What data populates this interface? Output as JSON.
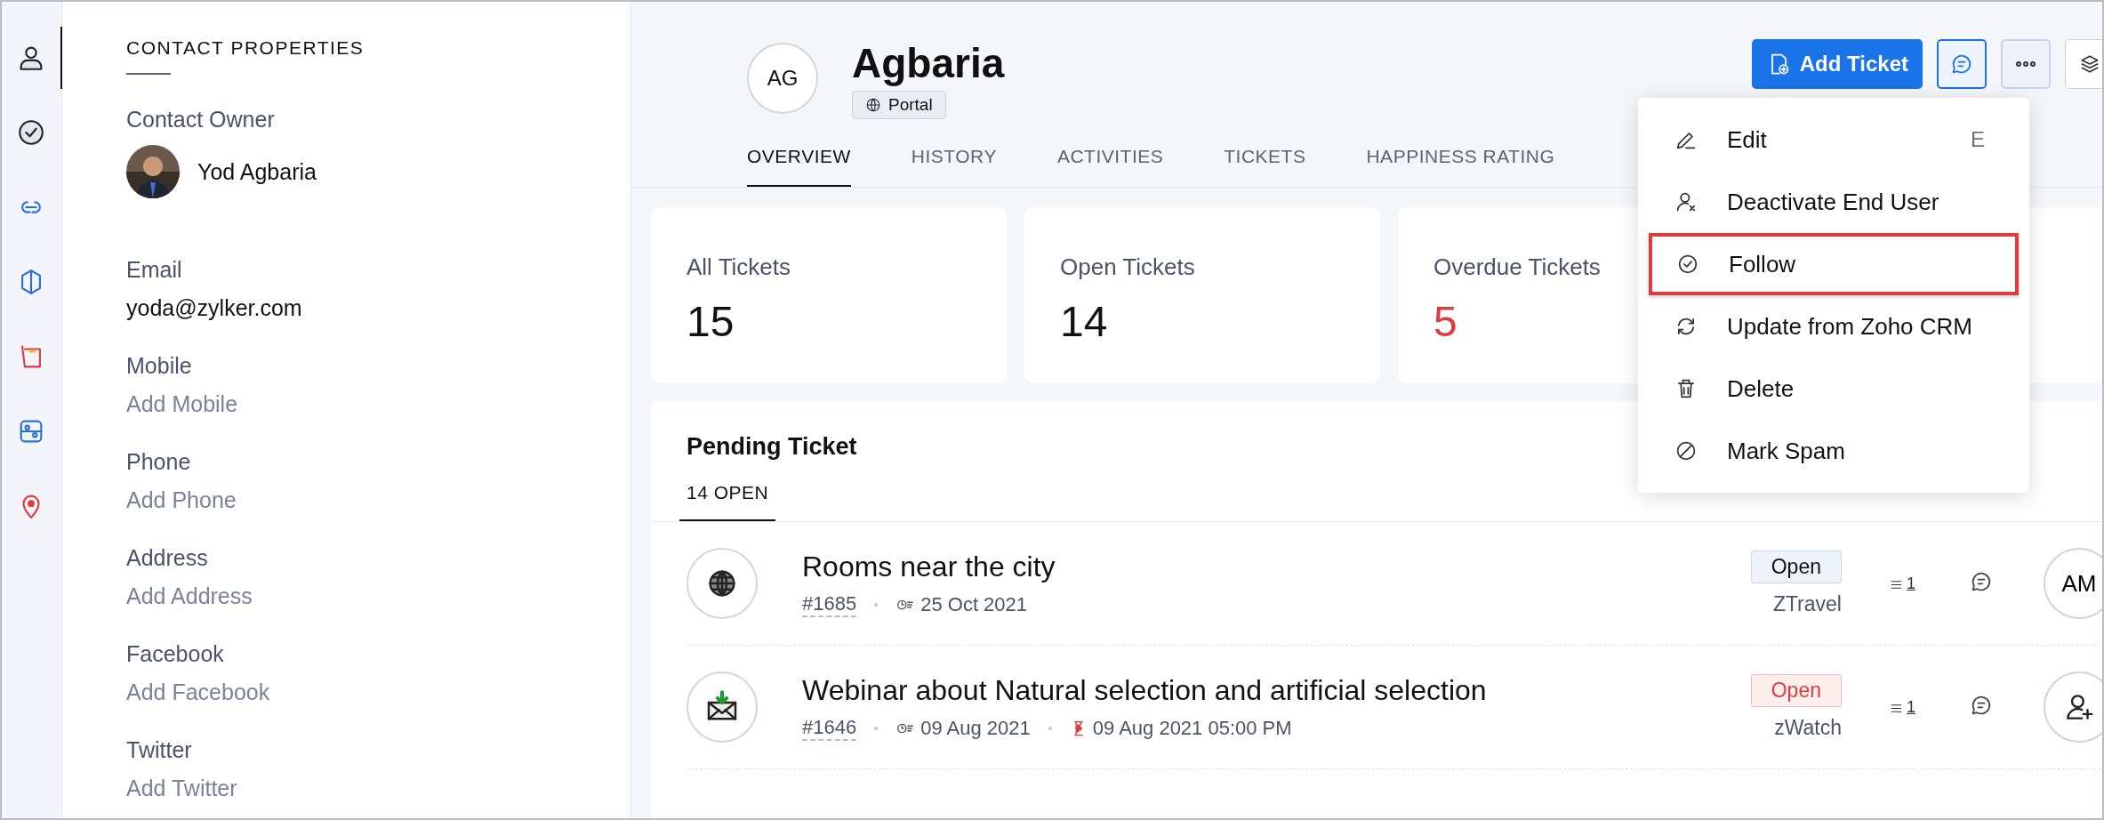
{
  "rail": [
    {
      "kind": "contact",
      "selected": true
    },
    {
      "kind": "check",
      "selected": false
    },
    {
      "kind": "link",
      "selected": false
    },
    {
      "kind": "hex",
      "selected": false
    },
    {
      "kind": "book",
      "selected": false
    },
    {
      "kind": "flow",
      "selected": false
    },
    {
      "kind": "pin",
      "selected": false
    }
  ],
  "properties": {
    "title": "CONTACT PROPERTIES",
    "owner": {
      "label": "Contact Owner",
      "name": "Yod Agbaria"
    },
    "fields": [
      {
        "label": "Email",
        "value": "yoda@zylker.com",
        "empty": false
      },
      {
        "label": "Mobile",
        "value": "Add Mobile",
        "empty": true
      },
      {
        "label": "Phone",
        "value": "Add Phone",
        "empty": true
      },
      {
        "label": "Address",
        "value": "Add Address",
        "empty": true
      },
      {
        "label": "Facebook",
        "value": "Add Facebook",
        "empty": true
      },
      {
        "label": "Twitter",
        "value": "Add Twitter",
        "empty": true
      }
    ]
  },
  "header": {
    "initials": "AG",
    "name": "Agbaria",
    "badge": "Portal",
    "add_button": "Add Ticket"
  },
  "tabs": [
    {
      "label": "OVERVIEW",
      "selected": true
    },
    {
      "label": "HISTORY",
      "selected": false
    },
    {
      "label": "ACTIVITIES",
      "selected": false
    },
    {
      "label": "TICKETS",
      "selected": false
    },
    {
      "label": "HAPPINESS RATING",
      "selected": false
    }
  ],
  "stats": [
    {
      "label": "All Tickets",
      "value": "15",
      "alert": false
    },
    {
      "label": "Open Tickets",
      "value": "14",
      "alert": false
    },
    {
      "label": "Overdue Tickets",
      "value": "5",
      "alert": true
    }
  ],
  "pending": {
    "title": "Pending Ticket",
    "tab": "14 OPEN",
    "rows": [
      {
        "kind": "web",
        "title": "Rooms near the city",
        "number": "#1685",
        "created": "25 Oct 2021",
        "status": "Open",
        "overdue": false,
        "department": "ZTravel",
        "thread_count": "1",
        "assignee": "AM"
      },
      {
        "kind": "email",
        "title": "Webinar about Natural selection and artificial selection",
        "number": "#1646",
        "created": "09 Aug 2021",
        "due": "09 Aug 2021 05:00 PM",
        "status": "Open",
        "overdue": true,
        "department": "zWatch",
        "thread_count": "1"
      }
    ]
  },
  "menu": [
    {
      "kind": "edit",
      "label": "Edit",
      "shortcut": "E",
      "highlighted": false
    },
    {
      "kind": "deactivate",
      "label": "Deactivate End User",
      "highlighted": false
    },
    {
      "kind": "follow",
      "label": "Follow",
      "highlighted": true
    },
    {
      "kind": "sync",
      "label": "Update from Zoho CRM",
      "highlighted": false
    },
    {
      "kind": "delete",
      "label": "Delete",
      "highlighted": false
    },
    {
      "kind": "spam",
      "label": "Mark Spam",
      "highlighted": false
    }
  ]
}
